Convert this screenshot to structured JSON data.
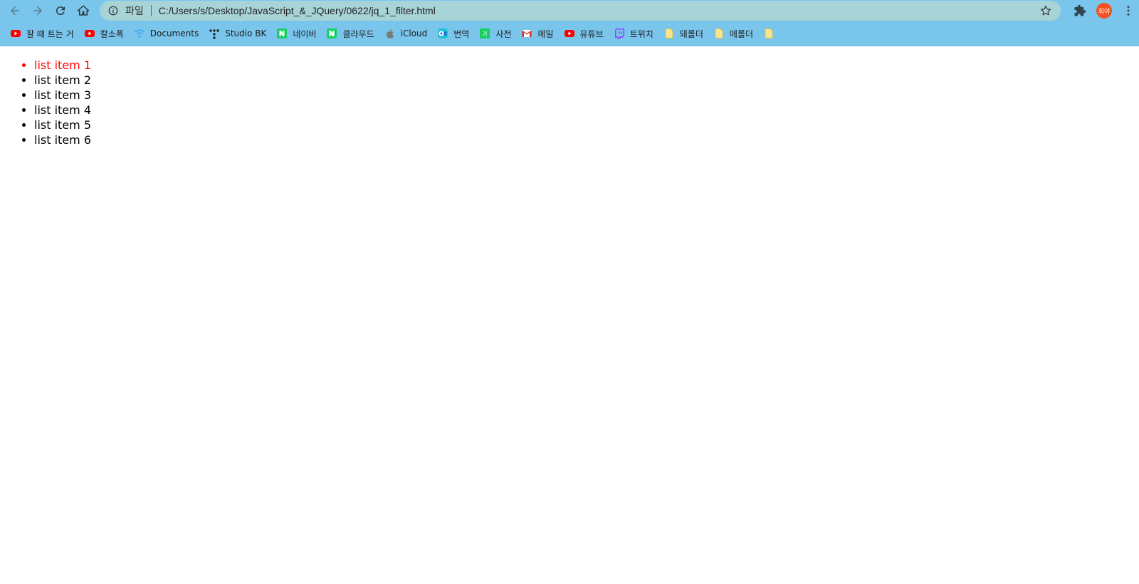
{
  "toolbar": {
    "scheme_label": "파일",
    "url": "C:/Users/s/Desktop/JavaScript_&_JQuery/0622/jq_1_filter.html",
    "avatar_label": "희야"
  },
  "bookmarks": [
    {
      "label": "잘 때 트는 거",
      "icon": "youtube-icon"
    },
    {
      "label": "칼소폭",
      "icon": "youtube-icon"
    },
    {
      "label": "Documents",
      "icon": "wifi-icon"
    },
    {
      "label": "Studio BK",
      "icon": "dots-icon"
    },
    {
      "label": "네이버",
      "icon": "naver-icon"
    },
    {
      "label": "클라우드",
      "icon": "naver-icon"
    },
    {
      "label": "iCloud",
      "icon": "apple-icon"
    },
    {
      "label": "번역",
      "icon": "papago-icon"
    },
    {
      "label": "사전",
      "icon": "dictionary-icon"
    },
    {
      "label": "메일",
      "icon": "gmail-icon"
    },
    {
      "label": "유튜브",
      "icon": "youtube-icon"
    },
    {
      "label": "트위치",
      "icon": "twitch-icon"
    },
    {
      "label": "돼롤더",
      "icon": "folder-icon"
    },
    {
      "label": "메롤더",
      "icon": "folder-icon"
    },
    {
      "label": "",
      "icon": "folder-icon"
    }
  ],
  "page": {
    "items": [
      {
        "text": "list item 1",
        "highlighted": true
      },
      {
        "text": "list item 2",
        "highlighted": false
      },
      {
        "text": "list item 3",
        "highlighted": false
      },
      {
        "text": "list item 4",
        "highlighted": false
      },
      {
        "text": "list item 5",
        "highlighted": false
      },
      {
        "text": "list item 6",
        "highlighted": false
      }
    ]
  },
  "colors": {
    "chrome_bg": "#79c5ec",
    "address_bg": "#a8d3d7",
    "highlight": "#ff0000",
    "avatar_bg": "#f4511e"
  }
}
